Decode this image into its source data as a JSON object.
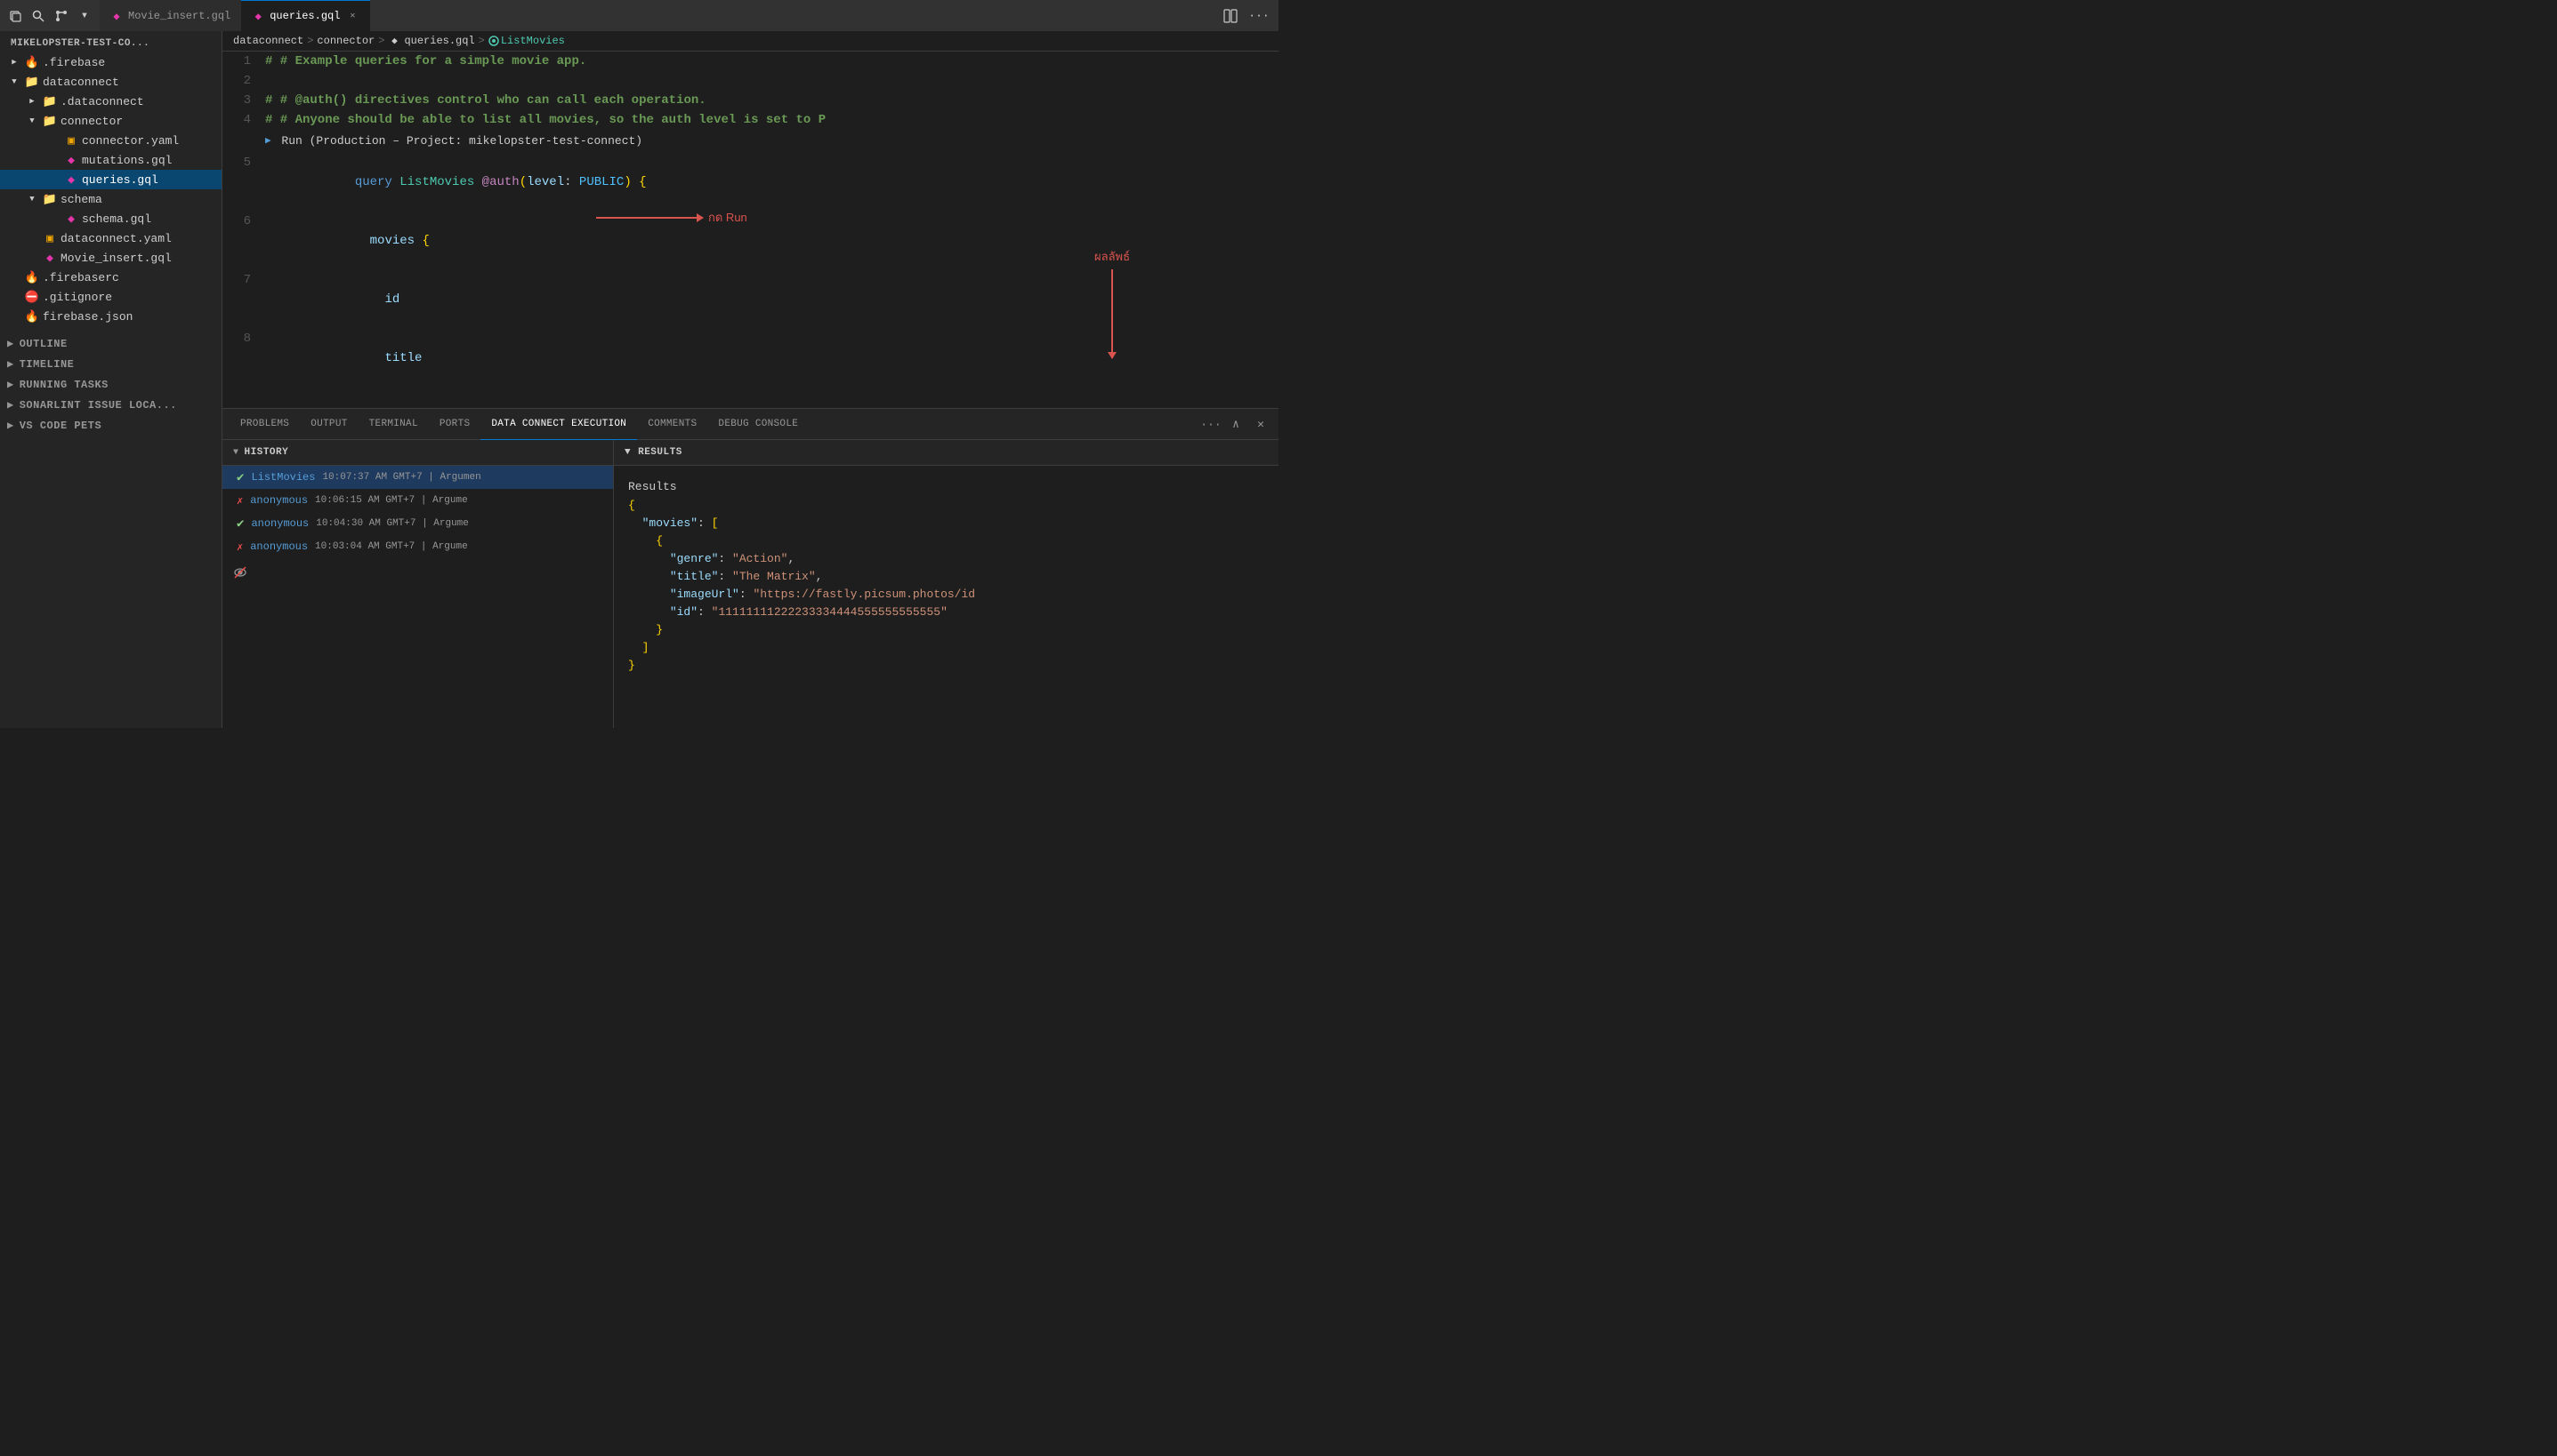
{
  "titlebar": {
    "icons": [
      "copy-icon",
      "search-icon",
      "branch-icon",
      "chevron-down-icon"
    ],
    "tabs": [
      {
        "id": "tab-movie-insert",
        "label": "Movie_insert.gql",
        "active": false,
        "icon": "gql-icon"
      },
      {
        "id": "tab-queries",
        "label": "queries.gql",
        "active": true,
        "icon": "gql-icon"
      }
    ],
    "actions": [
      "layout-icon",
      "more-icon"
    ]
  },
  "sidebar": {
    "header": "MIKELOPSTER-TEST-CO...",
    "tree": [
      {
        "id": "firebase",
        "label": ".firebase",
        "type": "folder",
        "depth": 0,
        "expanded": false,
        "arrow": "▶"
      },
      {
        "id": "dataconnect",
        "label": "dataconnect",
        "type": "folder",
        "depth": 0,
        "expanded": true,
        "arrow": "▼"
      },
      {
        "id": "dataconnect-child",
        "label": ".dataconnect",
        "type": "folder",
        "depth": 1,
        "expanded": false,
        "arrow": "▶"
      },
      {
        "id": "connector",
        "label": "connector",
        "type": "folder",
        "depth": 1,
        "expanded": true,
        "arrow": "▼"
      },
      {
        "id": "connector-yaml",
        "label": "connector.yaml",
        "type": "file-yaml",
        "depth": 2
      },
      {
        "id": "mutations-gql",
        "label": "mutations.gql",
        "type": "file-gql",
        "depth": 2
      },
      {
        "id": "queries-gql",
        "label": "queries.gql",
        "type": "file-gql",
        "depth": 2,
        "selected": true
      },
      {
        "id": "schema",
        "label": "schema",
        "type": "folder",
        "depth": 1,
        "expanded": true,
        "arrow": "▼"
      },
      {
        "id": "schema-gql",
        "label": "schema.gql",
        "type": "file-gql",
        "depth": 2
      },
      {
        "id": "dataconnect-yaml",
        "label": "dataconnect.yaml",
        "type": "file-yaml",
        "depth": 1
      },
      {
        "id": "movie-insert-gql",
        "label": "Movie_insert.gql",
        "type": "file-gql",
        "depth": 1
      },
      {
        "id": "firebaserc",
        "label": ".firebaserc",
        "type": "file-rc",
        "depth": 0
      },
      {
        "id": "gitignore",
        "label": ".gitignore",
        "type": "file-git",
        "depth": 0
      },
      {
        "id": "firebase-json",
        "label": "firebase.json",
        "type": "file-json",
        "depth": 0
      }
    ],
    "bottom_sections": [
      {
        "id": "outline",
        "label": "OUTLINE"
      },
      {
        "id": "timeline",
        "label": "TIMELINE"
      },
      {
        "id": "running-tasks",
        "label": "RUNNING TASKS"
      },
      {
        "id": "sonarlint",
        "label": "SONARLINT ISSUE LOCA..."
      },
      {
        "id": "vs-code-pets",
        "label": "VS CODE PETS"
      }
    ]
  },
  "breadcrumb": {
    "parts": [
      "dataconnect",
      ">",
      "connector",
      ">",
      "queries.gql",
      ">",
      "ListMovies"
    ]
  },
  "editor": {
    "filename": "queries.gql",
    "lines": [
      {
        "num": 1,
        "content": "# # Example queries for a simple movie app."
      },
      {
        "num": 2,
        "content": ""
      },
      {
        "num": 3,
        "content": "# # @auth() directives control who can call each operation."
      },
      {
        "num": 4,
        "content": "# # Anyone should be able to list all movies, so the auth level is set to P"
      },
      {
        "num": "run",
        "content": "▶ Run (Production – Project: mikelopster-test-connect)"
      },
      {
        "num": 5,
        "content": "query ListMovies @auth(level: PUBLIC) {"
      },
      {
        "num": 6,
        "content": "  movies {"
      },
      {
        "num": 7,
        "content": "    id"
      },
      {
        "num": 8,
        "content": "    title"
      }
    ],
    "annotation_run_label": "กด Run",
    "annotation_result_label": "ผลลัพธ์"
  },
  "panel": {
    "tabs": [
      {
        "id": "problems",
        "label": "PROBLEMS"
      },
      {
        "id": "output",
        "label": "OUTPUT"
      },
      {
        "id": "terminal",
        "label": "TERMINAL"
      },
      {
        "id": "ports",
        "label": "PORTS"
      },
      {
        "id": "data-connect-execution",
        "label": "DATA CONNECT EXECUTION",
        "active": true
      },
      {
        "id": "comments",
        "label": "COMMENTS"
      },
      {
        "id": "debug-console",
        "label": "DEBUG CONSOLE"
      }
    ],
    "history": {
      "header": "HISTORY",
      "items": [
        {
          "id": "h1",
          "status": "ok",
          "name": "ListMovies",
          "time": "10:07:37 AM GMT+7",
          "args": "| Argumen",
          "selected": true
        },
        {
          "id": "h2",
          "status": "err",
          "name": "anonymous",
          "time": "10:06:15 AM GMT+7",
          "args": "| Argume"
        },
        {
          "id": "h3",
          "status": "ok",
          "name": "anonymous",
          "time": "10:04:30 AM GMT+7",
          "args": "| Argume"
        },
        {
          "id": "h4",
          "status": "err",
          "name": "anonymous",
          "time": "10:03:04 AM GMT+7",
          "args": "| Argume"
        }
      ]
    },
    "results": {
      "header": "RESULTS",
      "title": "Results",
      "json": "{\n  \"movies\": [\n    {\n      \"genre\": \"Action\",\n      \"title\": \"The Matrix\",\n      \"imageUrl\": \"https://fastly.picsum.photos/id\n      \"id\": \"11111111222233334444555555555555\"\n    }\n  ]\n}"
    }
  }
}
